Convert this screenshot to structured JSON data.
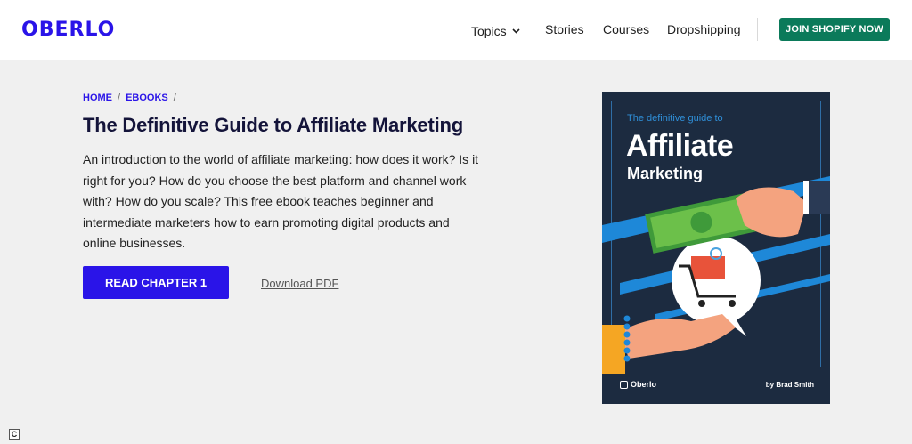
{
  "header": {
    "logo": "OBERLO",
    "nav": {
      "topics": "Topics",
      "stories": "Stories",
      "courses": "Courses",
      "dropshipping": "Dropshipping"
    },
    "cta": "JOIN SHOPIFY NOW"
  },
  "breadcrumb": {
    "home": "HOME",
    "ebooks": "EBOOKS"
  },
  "page": {
    "title": "The Definitive Guide to Affiliate Marketing",
    "description": "An introduction to the world of affiliate marketing: how does it work? Is it right for you? How do you choose the best platform and channel work with? How do you scale? This free ebook teaches beginner and intermediate marketers how to earn promoting digital products and online businesses.",
    "read_button": "READ CHAPTER 1",
    "download_link": "Download PDF"
  },
  "cover": {
    "subtitle": "The definitive guide to",
    "title_line1": "Affiliate",
    "title_line2": "Marketing",
    "brand": "Oberlo",
    "author": "by Brad Smith"
  },
  "colors": {
    "brand": "#2a14e8",
    "cta_green": "#0b7a5a",
    "cover_bg": "#1c2b40",
    "accent_blue": "#1e88d8"
  },
  "icons": {
    "topics_dropdown": "chevron-down-icon",
    "corner": "c-badge-icon"
  }
}
